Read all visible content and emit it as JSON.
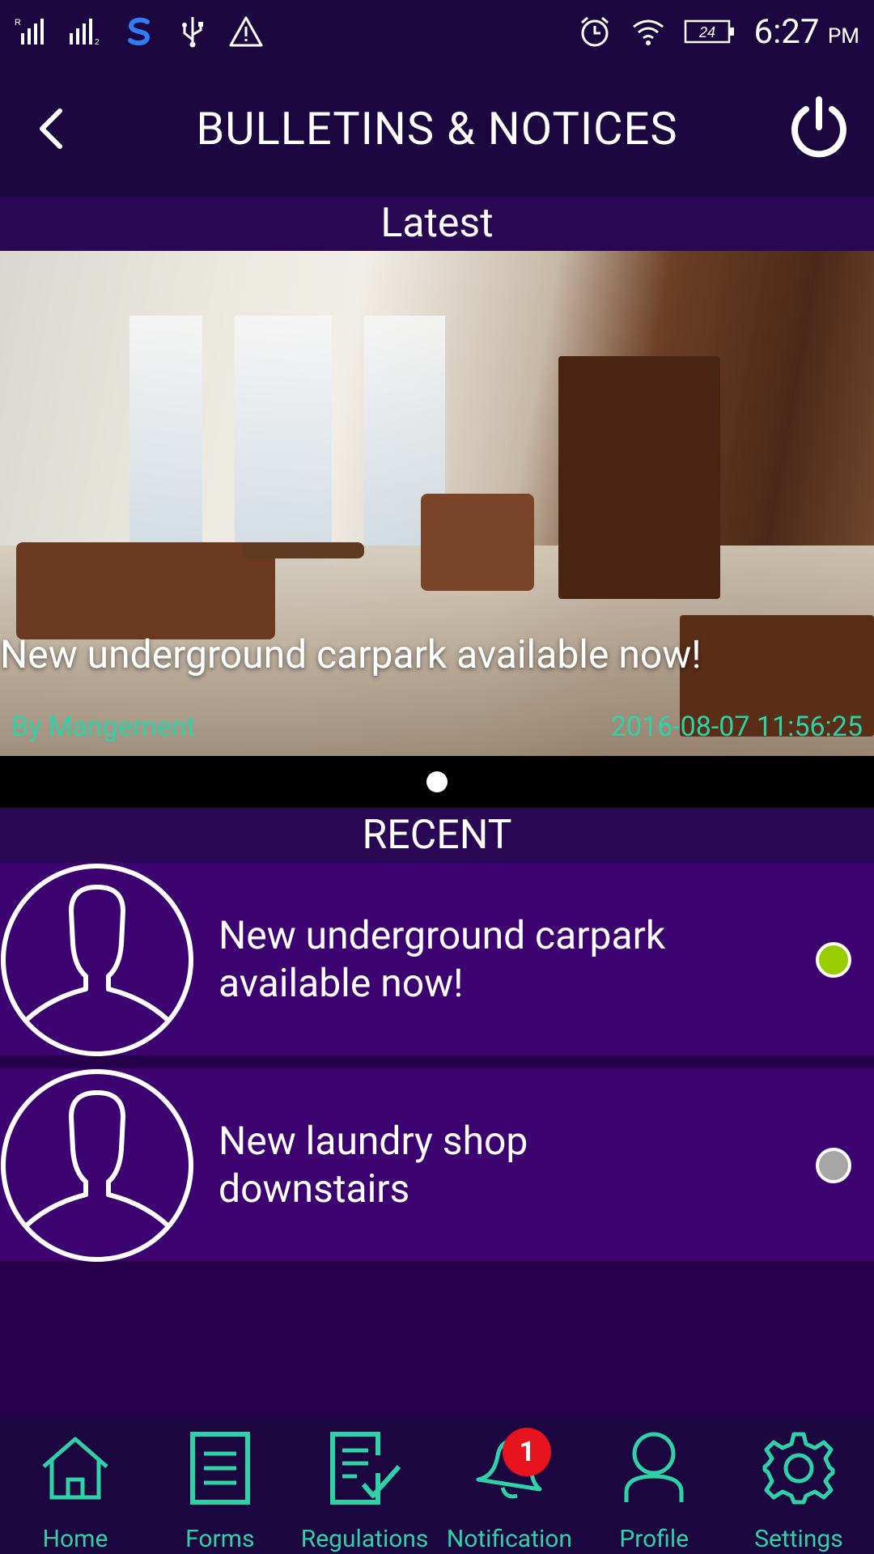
{
  "status_bar": {
    "left_icons": [
      "signal-r-icon",
      "signal-2-icon",
      "swiftkey-icon",
      "usb-icon",
      "warning-icon"
    ],
    "right_icons": [
      "alarm-icon",
      "wifi-icon",
      "battery-icon"
    ],
    "battery": "24",
    "time": "6:27",
    "ampm": "PM"
  },
  "header": {
    "title": "BULLETINS & NOTICES",
    "back_icon": "chevron-left-icon",
    "power_icon": "power-icon"
  },
  "latest": {
    "heading": "Latest",
    "slides": [
      {
        "title": "New underground carpark available now!",
        "author": "By Mangement",
        "date": "2016-08-07 11:56:25"
      }
    ],
    "active_slide": 1
  },
  "recent": {
    "heading": "RECENT",
    "items": [
      {
        "title": "New underground carpark available now!",
        "line1": "New underground carpark",
        "line2": "available now!",
        "status_color": "#9acd00"
      },
      {
        "title": "New laundry shop downstairs",
        "line1": "New laundry shop",
        "line2": "downstairs",
        "status_color": "#a6a6a6"
      }
    ]
  },
  "nav": {
    "items": [
      {
        "label": "Home",
        "icon": "home-icon"
      },
      {
        "label": "Forms",
        "icon": "document-icon"
      },
      {
        "label": "Regulations",
        "icon": "checklist-icon"
      },
      {
        "label": "Notification",
        "icon": "bell-icon",
        "badge": "1"
      },
      {
        "label": "Profile",
        "icon": "person-icon"
      },
      {
        "label": "Settings",
        "icon": "gear-icon"
      }
    ]
  },
  "colors": {
    "background": "#26004a",
    "bar": "#1b0640",
    "list_item": "#3b0270",
    "accent": "#2fd2a6",
    "badge": "#e8141d"
  }
}
